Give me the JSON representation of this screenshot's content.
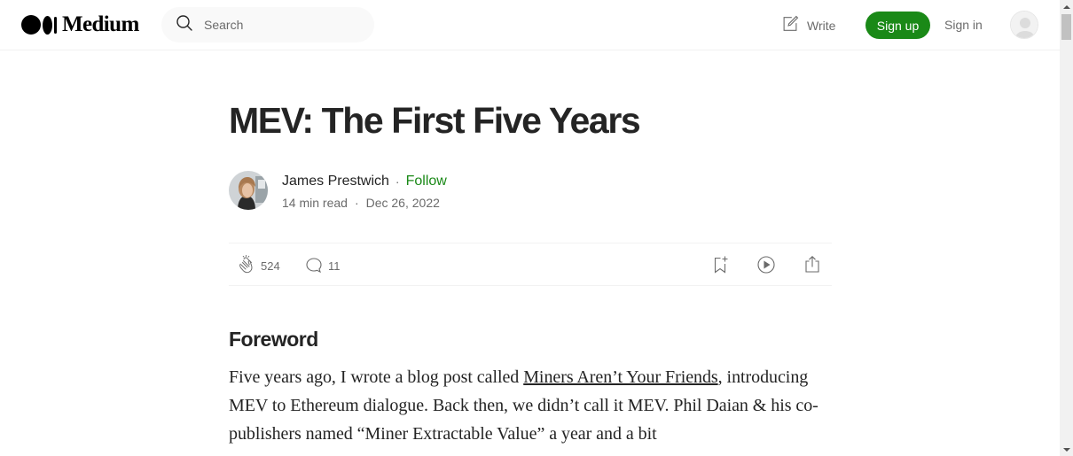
{
  "header": {
    "logo_text": "Medium",
    "search_placeholder": "Search",
    "write_label": "Write",
    "signup_label": "Sign up",
    "signin_label": "Sign in"
  },
  "colors": {
    "accent_green": "#1a8917",
    "text_primary": "#242424",
    "text_secondary": "#6b6b6b"
  },
  "article": {
    "title": "MEV: The First Five Years",
    "author_name": "James Prestwich",
    "follow_label": "Follow",
    "read_time": "14 min read",
    "date": "Dec 26, 2022",
    "claps": "524",
    "responses": "11",
    "section_heading": "Foreword",
    "paragraph": {
      "before_link": "Five years ago, I wrote a blog post called ",
      "link_text": "Miners Aren’t Your Friends",
      "after_link": ", introducing MEV to Ethereum dialogue. Back then, we didn’t call it MEV. Phil Daian & his co-publishers named “Miner Extractable Value” a year and a bit"
    }
  },
  "icons": {
    "search": "search-icon",
    "write": "write-icon",
    "clap": "clap-icon",
    "response": "response-icon",
    "save": "bookmark-icon",
    "listen": "play-icon",
    "share": "share-icon"
  }
}
